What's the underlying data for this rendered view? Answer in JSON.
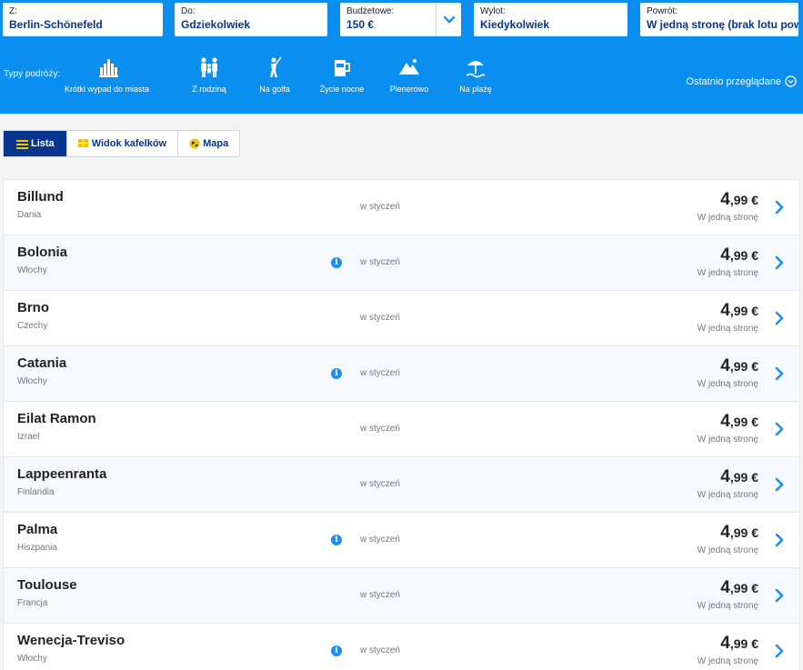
{
  "search": {
    "from": {
      "label": "Z:",
      "value": "Berlin-Schönefeld"
    },
    "to": {
      "label": "Do:",
      "value": "Gdziekolwiek"
    },
    "budget": {
      "label": "Budżetowe:",
      "value": "150 €"
    },
    "departure": {
      "label": "Wylot:",
      "value": "Kiedykolwiek"
    },
    "return": {
      "label": "Powrót:",
      "value": "W jedną stronę (brak lotu pow"
    }
  },
  "trip_types": {
    "label": "Typy podróży:",
    "items": [
      {
        "label": "Krótki wypad do miasta",
        "icon": "city-icon"
      },
      {
        "label": "Z rodziną",
        "icon": "family-icon"
      },
      {
        "label": "Na golfa",
        "icon": "golf-icon"
      },
      {
        "label": "Życie nocne",
        "icon": "nightlife-icon"
      },
      {
        "label": "Plenerowo",
        "icon": "mountain-icon"
      },
      {
        "label": "Na plażę",
        "icon": "beach-icon"
      }
    ]
  },
  "recently_viewed": "Ostatnio przeglądane",
  "views": {
    "list": "Lista",
    "tiles": "Widok kafelków",
    "map": "Mapa"
  },
  "results": [
    {
      "city": "Billund",
      "country": "Dania",
      "info": false,
      "month": "w styczeń",
      "price_int": "4",
      "price_dec": ",99 €",
      "fare_type": "W jedną stronę"
    },
    {
      "city": "Bolonia",
      "country": "Włochy",
      "info": true,
      "month": "w styczeń",
      "price_int": "4",
      "price_dec": ",99 €",
      "fare_type": "W jedną stronę"
    },
    {
      "city": "Brno",
      "country": "Czechy",
      "info": false,
      "month": "w styczeń",
      "price_int": "4",
      "price_dec": ",99 €",
      "fare_type": "W jedną stronę"
    },
    {
      "city": "Catania",
      "country": "Włochy",
      "info": true,
      "month": "w styczeń",
      "price_int": "4",
      "price_dec": ",99 €",
      "fare_type": "W jedną stronę"
    },
    {
      "city": "Eilat Ramon",
      "country": "Izrael",
      "info": false,
      "month": "w styczeń",
      "price_int": "4",
      "price_dec": ",99 €",
      "fare_type": "W jedną stronę"
    },
    {
      "city": "Lappeenranta",
      "country": "Finlandia",
      "info": false,
      "month": "w styczeń",
      "price_int": "4",
      "price_dec": ",99 €",
      "fare_type": "W jedną stronę"
    },
    {
      "city": "Palma",
      "country": "Hiszpania",
      "info": true,
      "month": "w styczeń",
      "price_int": "4",
      "price_dec": ",99 €",
      "fare_type": "W jedną stronę"
    },
    {
      "city": "Toulouse",
      "country": "Francja",
      "info": false,
      "month": "w styczeń",
      "price_int": "4",
      "price_dec": ",99 €",
      "fare_type": "W jedną stronę"
    },
    {
      "city": "Wenecja-Treviso",
      "country": "Włochy",
      "info": true,
      "month": "w styczeń",
      "price_int": "4",
      "price_dec": ",99 €",
      "fare_type": "W jedną stronę"
    }
  ],
  "colors": {
    "header_bg": "#0a8ef0",
    "brand_navy": "#073590",
    "accent_blue": "#1d8ff3",
    "tiles_yellow": "#f2c200"
  }
}
